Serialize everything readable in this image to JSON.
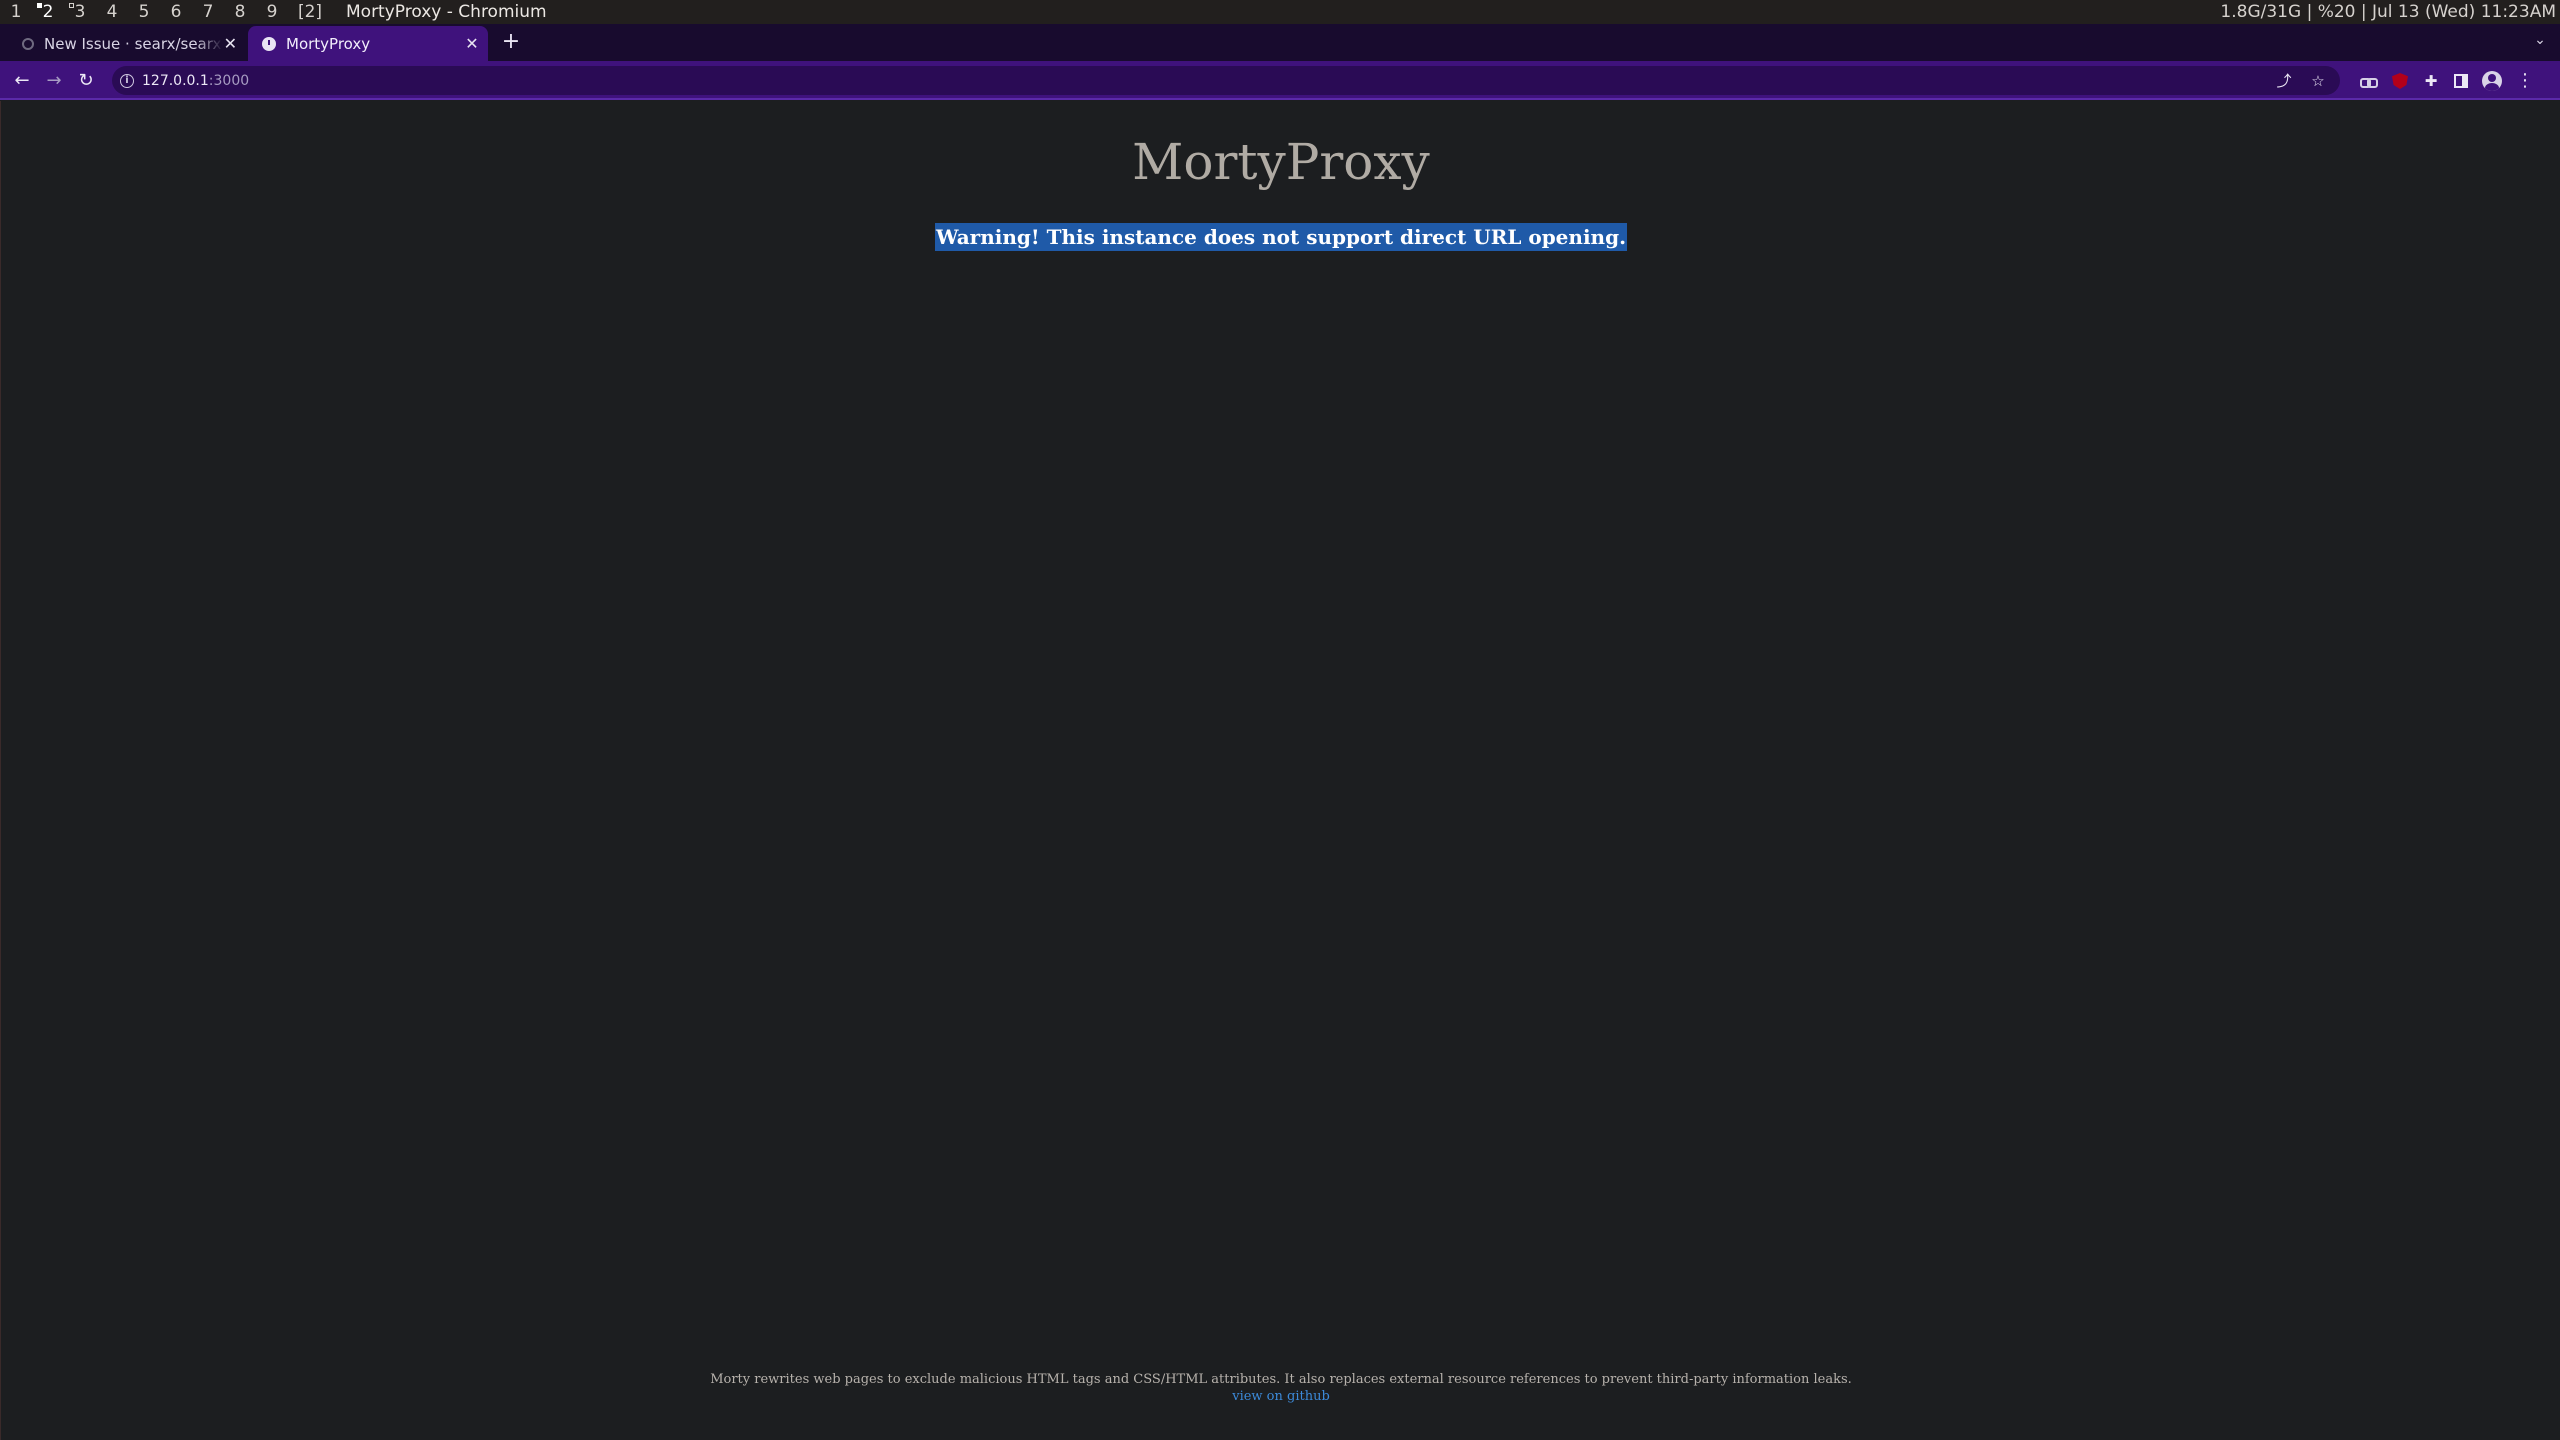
{
  "wm": {
    "workspaces": [
      "1",
      "2",
      "3",
      "4",
      "5",
      "6",
      "7",
      "8",
      "9"
    ],
    "scratch": "[2]",
    "window_title": "MortyProxy - Chromium",
    "status": "1.8G/31G | %20 | Jul 13 (Wed) 11:23AM"
  },
  "tabs": [
    {
      "label": "New Issue · searx/searx-docker",
      "active": false
    },
    {
      "label": "MortyProxy",
      "active": true
    }
  ],
  "toolbar": {
    "url_host": "127.0.0.1",
    "url_port": ":3000"
  },
  "page": {
    "title": "MortyProxy",
    "warning": "Warning! This instance does not support direct URL opening.",
    "footer_text": "Morty rewrites web pages to exclude malicious HTML tags and CSS/HTML attributes. It also replaces external resource references to prevent third-party information leaks.",
    "footer_link": "view on github"
  },
  "colors": {
    "tabstrip": "#180b2e",
    "toolbar": "#3f127c",
    "page_bg": "#1c1e20",
    "selection": "#1f5aa8",
    "link": "#3c8ad9"
  }
}
